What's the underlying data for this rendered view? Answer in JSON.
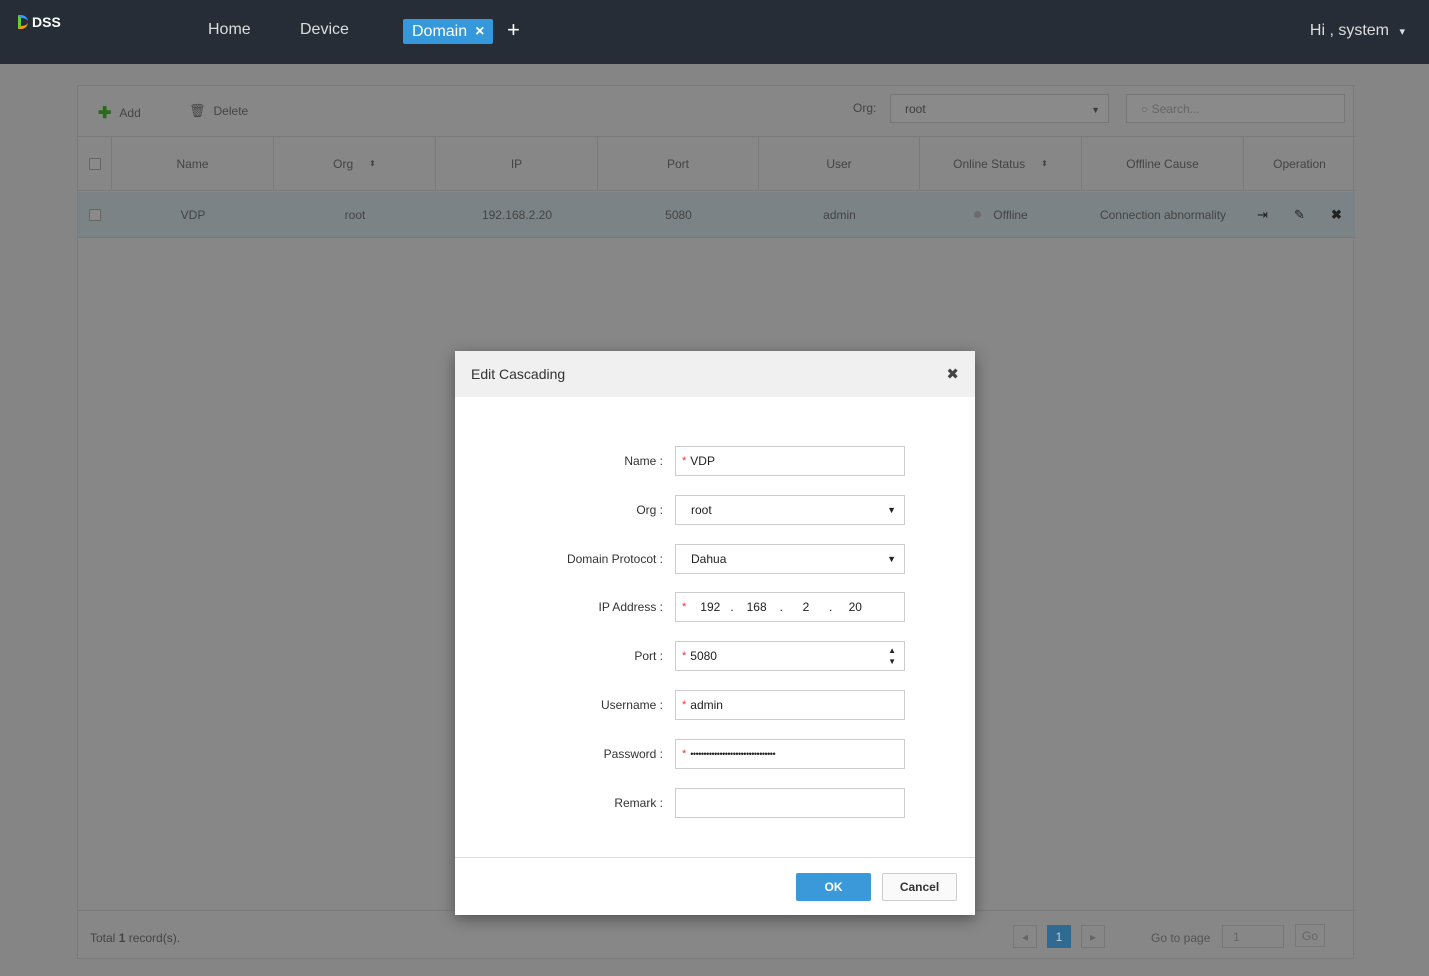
{
  "header": {
    "logo": "DSS",
    "nav": [
      "Home",
      "Device"
    ],
    "active_tab": "Domain",
    "close": "×",
    "add": "+",
    "user": "Hi , system",
    "user_caret": "▾"
  },
  "toolbar": {
    "add": "Add",
    "delete": "Delete",
    "org_label": "Org:",
    "org_value": "root",
    "search_placeholder": "Search..."
  },
  "table": {
    "columns": [
      "Name",
      "Org",
      "IP",
      "Port",
      "User",
      "Online Status",
      "Offline Cause",
      "Operation"
    ],
    "rows": [
      {
        "name": "VDP",
        "org": "root",
        "ip": "192.168.2.20",
        "port": "5080",
        "user": "admin",
        "status": "Offline",
        "cause": "Connection abnormality"
      }
    ]
  },
  "footer": {
    "total_prefix": "Total ",
    "total_count": "1",
    "total_suffix": " record(s).",
    "page": "1",
    "goto_label": "Go to page",
    "goto_value": "1",
    "go": "Go",
    "prev": "◂",
    "next": "▸"
  },
  "dialog": {
    "title": "Edit Cascading",
    "close": "✖",
    "labels": {
      "name": "Name :",
      "org": "Org :",
      "protocol": "Domain Protocot :",
      "ip": "IP Address :",
      "port": "Port :",
      "username": "Username :",
      "password": "Password :",
      "remark": "Remark :"
    },
    "values": {
      "name": "VDP",
      "org": "root",
      "protocol": "Dahua",
      "ip": [
        "192",
        "168",
        "2",
        "20"
      ],
      "port": "5080",
      "username": "admin",
      "password": "••••••••••••••••••••••••••••••••",
      "remark": ""
    },
    "required": "*",
    "dot": ".",
    "ok": "OK",
    "cancel": "Cancel"
  }
}
